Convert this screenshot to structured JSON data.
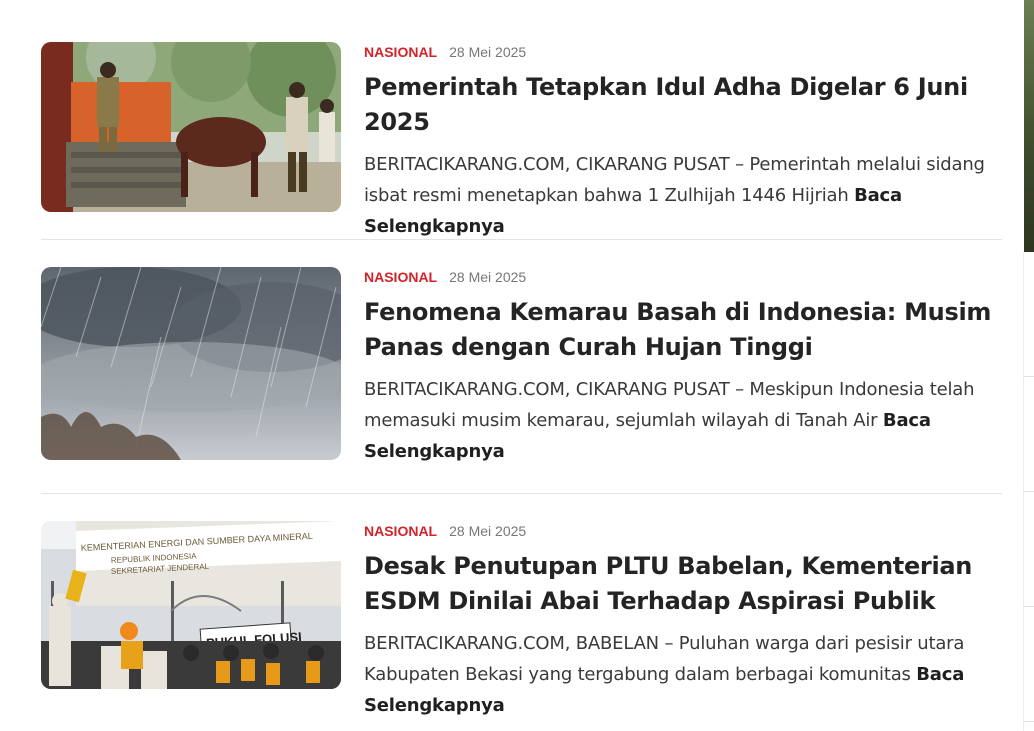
{
  "articles": [
    {
      "category": "NASIONAL",
      "date": "28 Mei 2025",
      "title": "Pemerintah Tetapkan Idul Adha Digelar 6 Juni 2025",
      "excerpt": "BERITACIKARANG.COM, CIKARANG PUSAT –  Pemerintah melalui sidang isbat resmi menetapkan bahwa 1 Zulhijah 1446 Hijriah",
      "read_more": "Baca Selengkapnya"
    },
    {
      "category": "NASIONAL",
      "date": "28 Mei 2025",
      "title": "Fenomena Kemarau Basah di Indonesia: Musim Panas dengan Curah Hujan Tinggi",
      "excerpt": "BERITACIKARANG.COM, CIKARANG PUSAT – Meskipun Indonesia telah memasuki musim kemarau, sejumlah wilayah di Tanah Air",
      "read_more": "Baca Selengkapnya"
    },
    {
      "category": "NASIONAL",
      "date": "28 Mei 2025",
      "title": "Desak Penutupan PLTU Babelan, Kementerian ESDM Dinilai Abai Terhadap Aspirasi Publik",
      "excerpt": "BERITACIKARANG.COM, BABELAN – Puluhan warga dari pesisir utara Kabupaten Bekasi yang tergabung dalam berbagai komunitas",
      "read_more": "Baca Selengkapnya"
    }
  ],
  "image_text": {
    "building_sign_1": "KEMENTERIAN ENERGI DAN SUMBER DAYA MINERAL",
    "building_sign_2": "REPUBLIK INDONESIA",
    "building_sign_3": "SEKRETARIAT JENDERAL",
    "banner": "PUKUL FOLUSI"
  }
}
